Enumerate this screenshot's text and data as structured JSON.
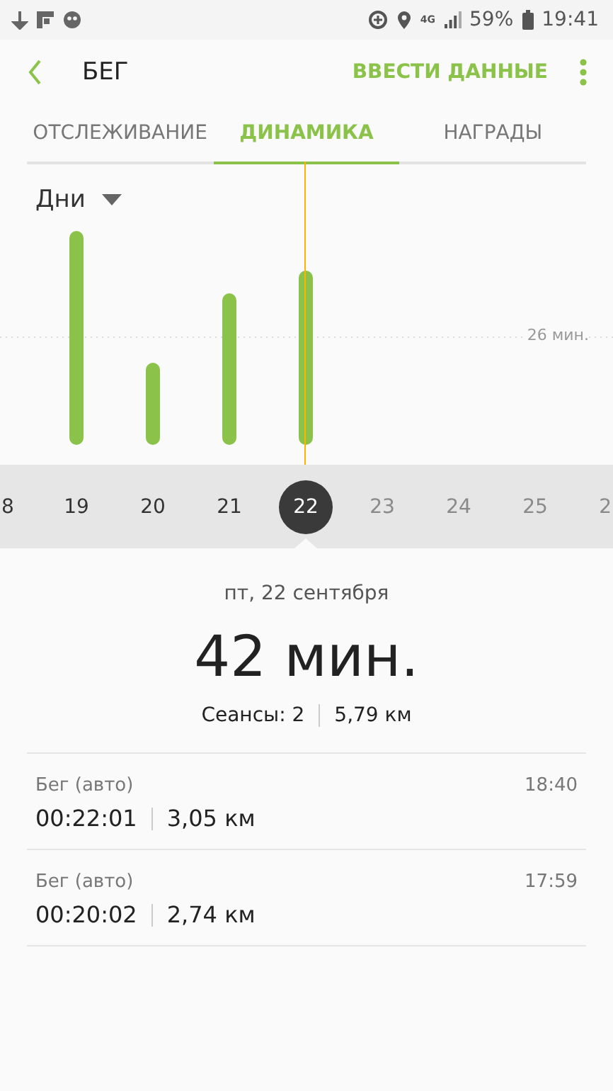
{
  "status_bar": {
    "battery": "59%",
    "time": "19:41",
    "network": "4G"
  },
  "header": {
    "title": "БЕГ",
    "action": "ВВЕСТИ ДАННЫЕ"
  },
  "tabs": [
    {
      "label": "ОТСЛЕЖИВАНИЕ",
      "selected": false
    },
    {
      "label": "ДИНАМИКА",
      "selected": true
    },
    {
      "label": "НАГРАДЫ",
      "selected": false
    }
  ],
  "period": {
    "value": "Дни"
  },
  "chart": {
    "reference_label": "26 мин."
  },
  "days": [
    {
      "label": "8",
      "selected": false,
      "future": false
    },
    {
      "label": "19",
      "selected": false,
      "future": false
    },
    {
      "label": "20",
      "selected": false,
      "future": false
    },
    {
      "label": "21",
      "selected": false,
      "future": false
    },
    {
      "label": "22",
      "selected": true,
      "future": false
    },
    {
      "label": "23",
      "selected": false,
      "future": true
    },
    {
      "label": "24",
      "selected": false,
      "future": true
    },
    {
      "label": "25",
      "selected": false,
      "future": true
    },
    {
      "label": "2",
      "selected": false,
      "future": true
    }
  ],
  "summary": {
    "date": "пт, 22 сентября",
    "total": "42 мин.",
    "sessions": "Сеансы: 2",
    "distance": "5,79 км"
  },
  "sessions": [
    {
      "name": "Бег (авто)",
      "time": "18:40",
      "duration": "00:22:01",
      "distance": "3,05 км"
    },
    {
      "name": "Бег (авто)",
      "time": "17:59",
      "duration": "00:20:02",
      "distance": "2,74 км"
    }
  ]
}
